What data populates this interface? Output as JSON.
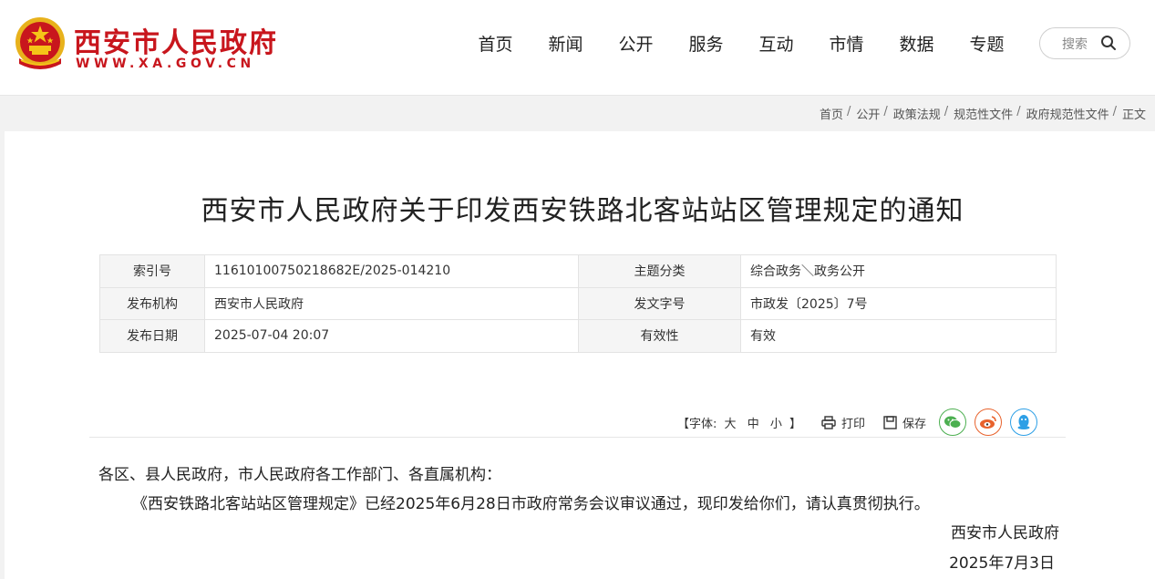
{
  "site": {
    "name": "西安市人民政府",
    "url": "WWW.XA.GOV.CN",
    "brand_color": "#c8161d"
  },
  "nav": {
    "items": [
      "首页",
      "新闻",
      "公开",
      "服务",
      "互动",
      "市情",
      "数据",
      "专题"
    ]
  },
  "search": {
    "placeholder": "搜索"
  },
  "breadcrumb": {
    "items": [
      "首页",
      "公开",
      "政策法规",
      "规范性文件",
      "政府规范性文件"
    ],
    "current": "正文"
  },
  "article": {
    "title": "西安市人民政府关于印发西安铁路北客站站区管理规定的通知",
    "meta": {
      "index_no_label": "索引号",
      "index_no": "11610100750218682E/2025-014210",
      "topic_label": "主题分类",
      "topic": "综合政务＼政务公开",
      "issuer_label": "发布机构",
      "issuer": "西安市人民政府",
      "doc_no_label": "发文字号",
      "doc_no": "市政发〔2025〕7号",
      "date_label": "发布日期",
      "date": "2025-07-04 20:07",
      "validity_label": "有效性",
      "validity": "有效"
    },
    "tools": {
      "font_label": "【字体:",
      "font_large": "大",
      "font_medium": "中",
      "font_small": "小",
      "font_close": "】",
      "print": "打印",
      "save": "保存"
    },
    "share_colors": {
      "wechat": "#4caf50",
      "weibo": "#e8622c",
      "qq": "#2d9fe6"
    },
    "salutation": "各区、县人民政府，市人民政府各工作部门、各直属机构：",
    "paragraph": "《西安铁路北客站站区管理规定》已经2025年6月28日市政府常务会议审议通过，现印发给你们，请认真贯彻执行。",
    "signature": "西安市人民政府",
    "date": "2025年7月3日"
  }
}
